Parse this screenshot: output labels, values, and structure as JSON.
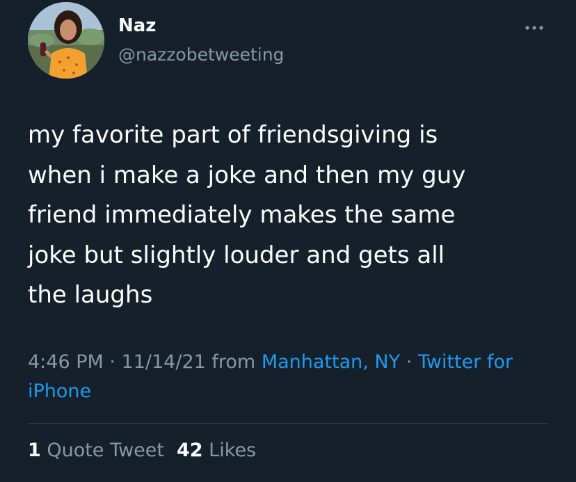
{
  "author": {
    "name": "Naz",
    "handle": "@nazzobetweeting"
  },
  "tweet": {
    "text": "my favorite part of friendsgiving is\nwhen i make a joke and then my guy\nfriend immediately makes the same\njoke but slightly louder and gets all\nthe laughs"
  },
  "meta": {
    "time": "4:46 PM",
    "separator": " · ",
    "date": "11/14/21",
    "from": " from ",
    "location": "Manhattan, NY",
    "source": "Twitter for iPhone"
  },
  "stats": {
    "quote_count": "1",
    "quote_label": "Quote Tweet",
    "likes_count": "42",
    "likes_label": "Likes"
  },
  "icons": {
    "more": "more-horizontal-icon"
  },
  "colors": {
    "background": "#15202b",
    "primary_text": "#ffffff",
    "secondary_text": "#8899a6",
    "link": "#1d9bf0",
    "divider": "#38444d"
  }
}
